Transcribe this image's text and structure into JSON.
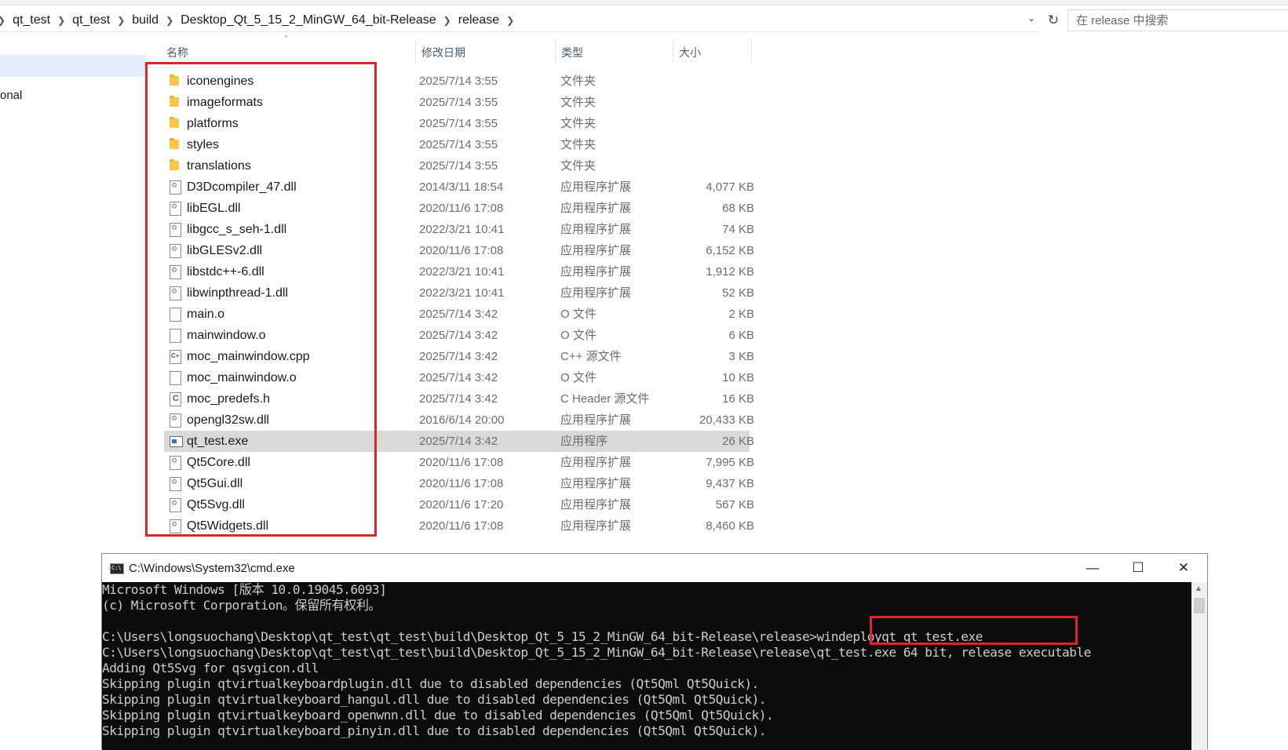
{
  "breadcrumb": [
    "qt_test",
    "qt_test",
    "build",
    "Desktop_Qt_5_15_2_MinGW_64_bit-Release",
    "release"
  ],
  "search": {
    "placeholder": "在 release 中搜索"
  },
  "nav": {
    "partial_item": "onal"
  },
  "columns": {
    "name": "名称",
    "date": "修改日期",
    "type": "类型",
    "size": "大小"
  },
  "files": [
    {
      "name": "iconengines",
      "date": "2025/7/14 3:55",
      "type": "文件夹",
      "size": "",
      "icon": "folder-icon"
    },
    {
      "name": "imageformats",
      "date": "2025/7/14 3:55",
      "type": "文件夹",
      "size": "",
      "icon": "folder-icon"
    },
    {
      "name": "platforms",
      "date": "2025/7/14 3:55",
      "type": "文件夹",
      "size": "",
      "icon": "folder-icon"
    },
    {
      "name": "styles",
      "date": "2025/7/14 3:55",
      "type": "文件夹",
      "size": "",
      "icon": "folder-icon"
    },
    {
      "name": "translations",
      "date": "2025/7/14 3:55",
      "type": "文件夹",
      "size": "",
      "icon": "folder-icon"
    },
    {
      "name": "D3Dcompiler_47.dll",
      "date": "2014/3/11 18:54",
      "type": "应用程序扩展",
      "size": "4,077 KB",
      "icon": "dll-icon"
    },
    {
      "name": "libEGL.dll",
      "date": "2020/11/6 17:08",
      "type": "应用程序扩展",
      "size": "68 KB",
      "icon": "dll-icon"
    },
    {
      "name": "libgcc_s_seh-1.dll",
      "date": "2022/3/21 10:41",
      "type": "应用程序扩展",
      "size": "74 KB",
      "icon": "dll-icon"
    },
    {
      "name": "libGLESv2.dll",
      "date": "2020/11/6 17:08",
      "type": "应用程序扩展",
      "size": "6,152 KB",
      "icon": "dll-icon"
    },
    {
      "name": "libstdc++-6.dll",
      "date": "2022/3/21 10:41",
      "type": "应用程序扩展",
      "size": "1,912 KB",
      "icon": "dll-icon"
    },
    {
      "name": "libwinpthread-1.dll",
      "date": "2022/3/21 10:41",
      "type": "应用程序扩展",
      "size": "52 KB",
      "icon": "dll-icon"
    },
    {
      "name": "main.o",
      "date": "2025/7/14 3:42",
      "type": "O 文件",
      "size": "2 KB",
      "icon": "blank-file-icon"
    },
    {
      "name": "mainwindow.o",
      "date": "2025/7/14 3:42",
      "type": "O 文件",
      "size": "6 KB",
      "icon": "blank-file-icon"
    },
    {
      "name": "moc_mainwindow.cpp",
      "date": "2025/7/14 3:42",
      "type": "C++ 源文件",
      "size": "3 KB",
      "icon": "cpp-file-icon"
    },
    {
      "name": "moc_mainwindow.o",
      "date": "2025/7/14 3:42",
      "type": "O 文件",
      "size": "10 KB",
      "icon": "blank-file-icon"
    },
    {
      "name": "moc_predefs.h",
      "date": "2025/7/14 3:42",
      "type": "C Header 源文件",
      "size": "16 KB",
      "icon": "header-file-icon"
    },
    {
      "name": "opengl32sw.dll",
      "date": "2016/6/14 20:00",
      "type": "应用程序扩展",
      "size": "20,433 KB",
      "icon": "dll-icon"
    },
    {
      "name": "qt_test.exe",
      "date": "2025/7/14 3:42",
      "type": "应用程序",
      "size": "26 KB",
      "icon": "exe-icon",
      "selected": true
    },
    {
      "name": "Qt5Core.dll",
      "date": "2020/11/6 17:08",
      "type": "应用程序扩展",
      "size": "7,995 KB",
      "icon": "dll-icon"
    },
    {
      "name": "Qt5Gui.dll",
      "date": "2020/11/6 17:08",
      "type": "应用程序扩展",
      "size": "9,437 KB",
      "icon": "dll-icon"
    },
    {
      "name": "Qt5Svg.dll",
      "date": "2020/11/6 17:20",
      "type": "应用程序扩展",
      "size": "567 KB",
      "icon": "dll-icon"
    },
    {
      "name": "Qt5Widgets.dll",
      "date": "2020/11/6 17:08",
      "type": "应用程序扩展",
      "size": "8,460 KB",
      "icon": "dll-icon"
    }
  ],
  "cmd": {
    "title": "C:\\Windows\\System32\\cmd.exe",
    "lines": [
      "Microsoft Windows [版本 10.0.19045.6093]",
      "(c) Microsoft Corporation。保留所有权利。",
      "",
      "C:\\Users\\longsuochang\\Desktop\\qt_test\\qt_test\\build\\Desktop_Qt_5_15_2_MinGW_64_bit-Release\\release>windeployqt qt_test.exe",
      "C:\\Users\\longsuochang\\Desktop\\qt_test\\qt_test\\build\\Desktop_Qt_5_15_2_MinGW_64_bit-Release\\release\\qt_test.exe 64 bit, release executable",
      "Adding Qt5Svg for qsvgicon.dll",
      "Skipping plugin qtvirtualkeyboardplugin.dll due to disabled dependencies (Qt5Qml Qt5Quick).",
      "Skipping plugin qtvirtualkeyboard_hangul.dll due to disabled dependencies (Qt5Qml Qt5Quick).",
      "Skipping plugin qtvirtualkeyboard_openwnn.dll due to disabled dependencies (Qt5Qml Qt5Quick).",
      "Skipping plugin qtvirtualkeyboard_pinyin.dll due to disabled dependencies (Qt5Qml Qt5Quick)."
    ]
  }
}
